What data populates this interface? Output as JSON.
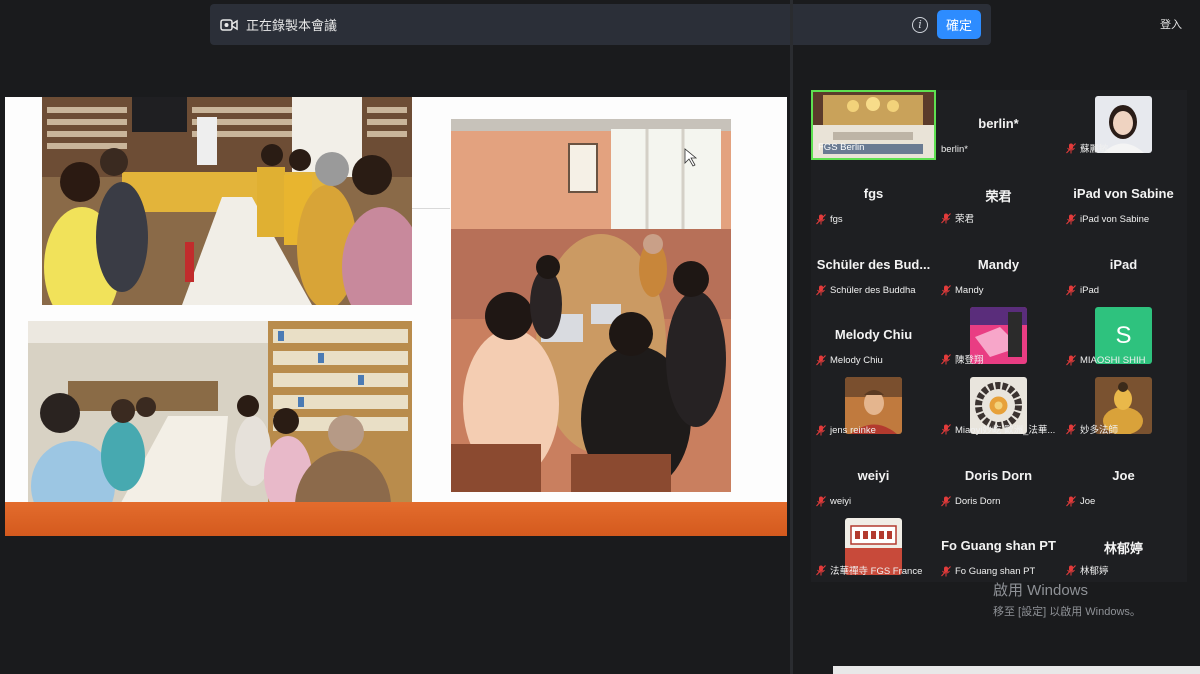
{
  "recording_bar": {
    "text": "正在錄製本會議",
    "ok_label": "確定"
  },
  "signin_label": "登入",
  "slide": {
    "description_hidden": true
  },
  "participants": [
    {
      "tile_name": "",
      "label": "FGS Berlin",
      "muted": false,
      "thumb": "hall",
      "active": true
    },
    {
      "tile_name": "berlin*",
      "label": "berlin*",
      "muted": false,
      "thumb": ""
    },
    {
      "tile_name": "",
      "label": "蘇麗敏",
      "muted": true,
      "thumb": "woman"
    },
    {
      "tile_name": "fgs",
      "label": "fgs",
      "muted": true,
      "thumb": ""
    },
    {
      "tile_name": "荣君",
      "label": "荣君",
      "muted": true,
      "thumb": ""
    },
    {
      "tile_name": "iPad von Sabine",
      "label": "iPad von Sabine",
      "muted": true,
      "thumb": ""
    },
    {
      "tile_name": "Schüler des Bud...",
      "label": "Schüler des Buddha",
      "muted": true,
      "thumb": ""
    },
    {
      "tile_name": "Mandy",
      "label": "Mandy",
      "muted": true,
      "thumb": ""
    },
    {
      "tile_name": "iPad",
      "label": "iPad",
      "muted": true,
      "thumb": ""
    },
    {
      "tile_name": "Melody Chiu",
      "label": "Melody Chiu",
      "muted": true,
      "thumb": ""
    },
    {
      "tile_name": "",
      "label": "陳登翔",
      "muted": true,
      "thumb": "pink"
    },
    {
      "tile_name": "",
      "label": "MIAOSHI SHIH",
      "muted": true,
      "thumb": "letter",
      "letter": "S"
    },
    {
      "tile_name": "",
      "label": "jens reinke",
      "muted": true,
      "thumb": "man"
    },
    {
      "tile_name": "",
      "label": "Miaoyi妙屹 歐洲_法華...",
      "muted": true,
      "thumb": "beads"
    },
    {
      "tile_name": "",
      "label": "妙多法師",
      "muted": true,
      "thumb": "buddha"
    },
    {
      "tile_name": "weiyi",
      "label": "weiyi",
      "muted": true,
      "thumb": ""
    },
    {
      "tile_name": "Doris Dorn",
      "label": "Doris Dorn",
      "muted": true,
      "thumb": ""
    },
    {
      "tile_name": "Joe",
      "label": "Joe",
      "muted": true,
      "thumb": ""
    },
    {
      "tile_name": "",
      "label": "法華禪寺 FGS France",
      "muted": true,
      "thumb": "temple"
    },
    {
      "tile_name": "Fo Guang shan PT",
      "label": "Fo Guang shan PT",
      "muted": true,
      "thumb": ""
    },
    {
      "tile_name": "林郁婷",
      "label": "林郁婷",
      "muted": true,
      "thumb": ""
    }
  ],
  "watermark": {
    "title": "啟用 Windows",
    "subtitle": "移至 [設定] 以啟用 Windows。"
  }
}
